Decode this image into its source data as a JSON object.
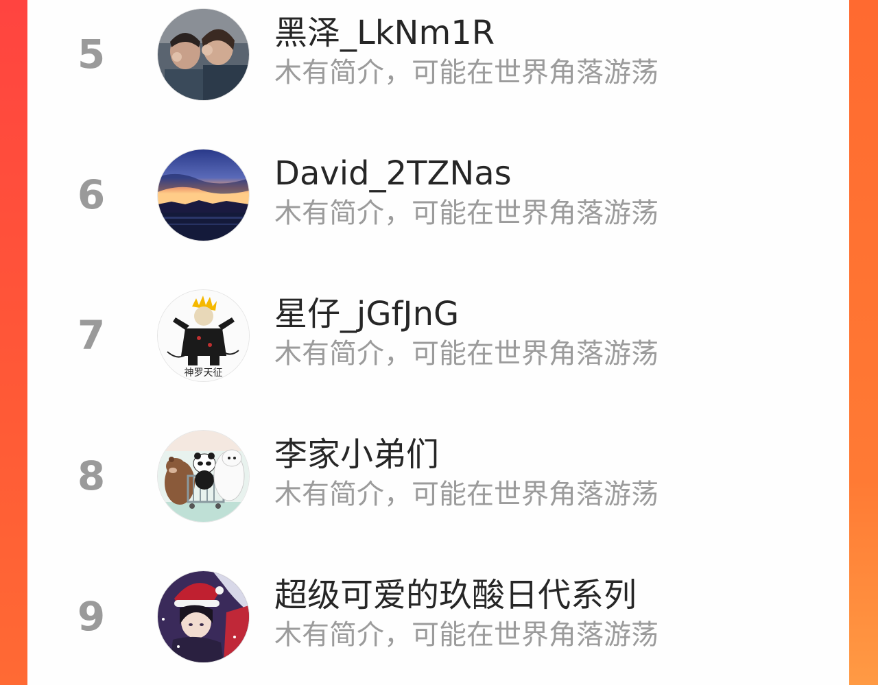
{
  "colors": {
    "accent": "#ff5a36",
    "name_text": "#262626",
    "bio_text": "#9b9b9b",
    "rank_text": "#9a9a9a"
  },
  "ranking": {
    "items": [
      {
        "rank": "5",
        "name": "黑泽_LkNm1R",
        "bio": "木有简介，可能在世界角落游荡",
        "avatar": "avatar-photo-two-people"
      },
      {
        "rank": "6",
        "name": "David_2TZNas",
        "bio": "木有简介，可能在世界角落游荡",
        "avatar": "avatar-sunset-sea"
      },
      {
        "rank": "7",
        "name": "星仔_jGfJnG",
        "bio": "木有简介，可能在世界角落游荡",
        "avatar": "avatar-anime-pain",
        "avatar_caption": "神罗天征"
      },
      {
        "rank": "8",
        "name": "李家小弟们",
        "bio": "木有简介，可能在世界角落游荡",
        "avatar": "avatar-bare-bears"
      },
      {
        "rank": "9",
        "name": "超级可爱的玖酸日代系列",
        "bio": "木有简介，可能在世界角落游荡",
        "avatar": "avatar-anime-santa-boy"
      }
    ]
  }
}
